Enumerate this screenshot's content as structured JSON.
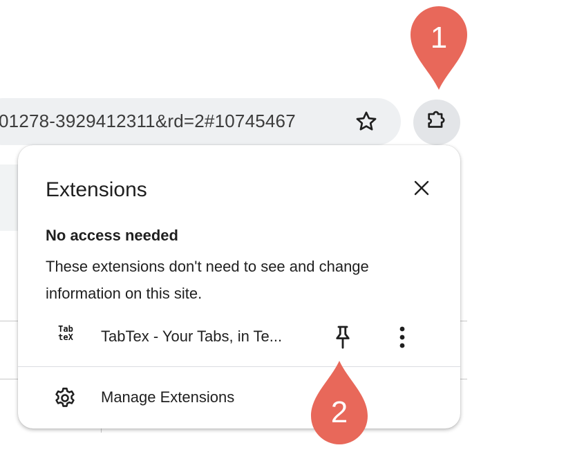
{
  "omnibox": {
    "url_text": "01278-3929412311&rd=2#10745467",
    "bookmark_icon": "star-icon"
  },
  "toolbar": {
    "extensions_icon": "puzzle-piece-icon"
  },
  "popup": {
    "title": "Extensions",
    "close_icon": "close-icon",
    "section_heading": "No access needed",
    "section_description": "These extensions don't need to see and change information on this site.",
    "extensions": [
      {
        "icon_text_line1": "Tab",
        "icon_text_line2": "teX",
        "name": "TabTex - Your Tabs, in Te...",
        "pin_icon": "pin-icon",
        "more_icon": "more-vertical-icon"
      }
    ],
    "manage_label": "Manage Extensions",
    "manage_icon": "gear-icon"
  },
  "annotations": {
    "marker_1": "1",
    "marker_2": "2",
    "marker_color": "#e8685a"
  }
}
